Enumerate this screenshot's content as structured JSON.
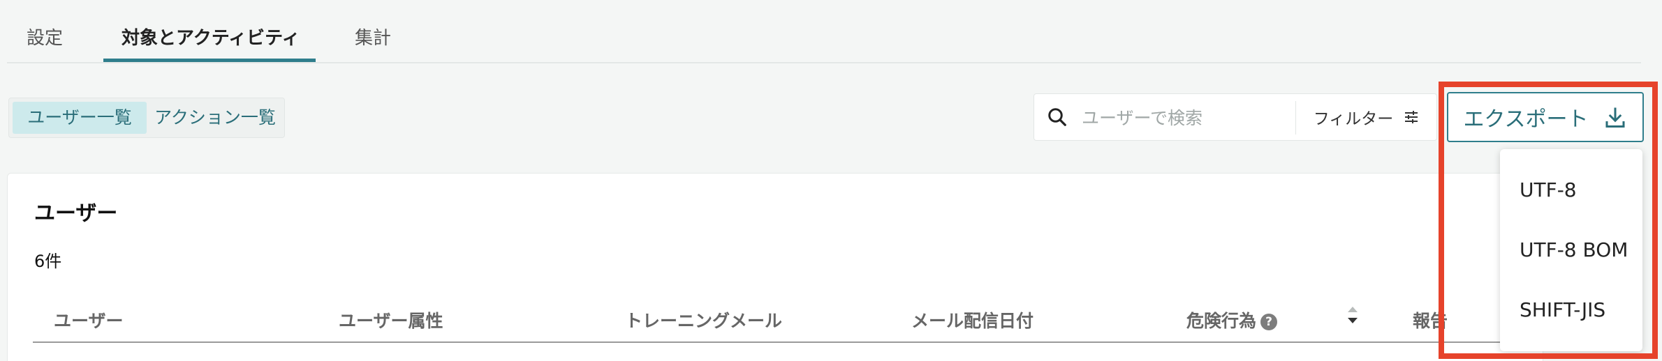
{
  "tabs": {
    "items": [
      {
        "label": "設定"
      },
      {
        "label": "対象とアクティビティ"
      },
      {
        "label": "集計"
      }
    ]
  },
  "segment": {
    "items": [
      {
        "label": "ユーザー一覧"
      },
      {
        "label": "アクション一覧"
      }
    ]
  },
  "search": {
    "placeholder": "ユーザーで検索",
    "value": ""
  },
  "filter": {
    "label": "フィルター"
  },
  "export": {
    "label": "エクスポート",
    "options": [
      {
        "label": "UTF-8"
      },
      {
        "label": "UTF-8 BOM"
      },
      {
        "label": "SHIFT-JIS"
      }
    ]
  },
  "users_panel": {
    "title": "ユーザー",
    "count": "6件",
    "columns": [
      {
        "label": "ユーザー"
      },
      {
        "label": "ユーザー属性"
      },
      {
        "label": "トレーニングメール"
      },
      {
        "label": "メール配信日付"
      },
      {
        "label": "危険行為"
      },
      {
        "label": "報告"
      }
    ]
  },
  "icons": {
    "search": "search-icon",
    "filter": "sliders-icon",
    "export": "download-icon",
    "help": "question-circle-icon",
    "sort": "sort-icon"
  },
  "colors": {
    "accent": "#2f7e8c",
    "segment_active_bg": "#cdeaec",
    "highlight_border": "#e6432b",
    "background": "#f4f6f5"
  }
}
